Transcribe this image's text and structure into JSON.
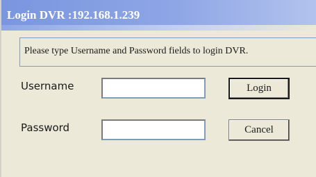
{
  "window": {
    "title": "Login DVR :192.168.1.239"
  },
  "message": {
    "text": "Please type Username and Password fields to login DVR."
  },
  "form": {
    "username_label": "Username",
    "username_value": "",
    "password_label": "Password",
    "password_value": ""
  },
  "buttons": {
    "login_label": "Login",
    "cancel_label": "Cancel"
  },
  "colors": {
    "titlebar": "#7a96df",
    "dialog_background": "#ece9d8",
    "title_text": "#ffffff"
  }
}
